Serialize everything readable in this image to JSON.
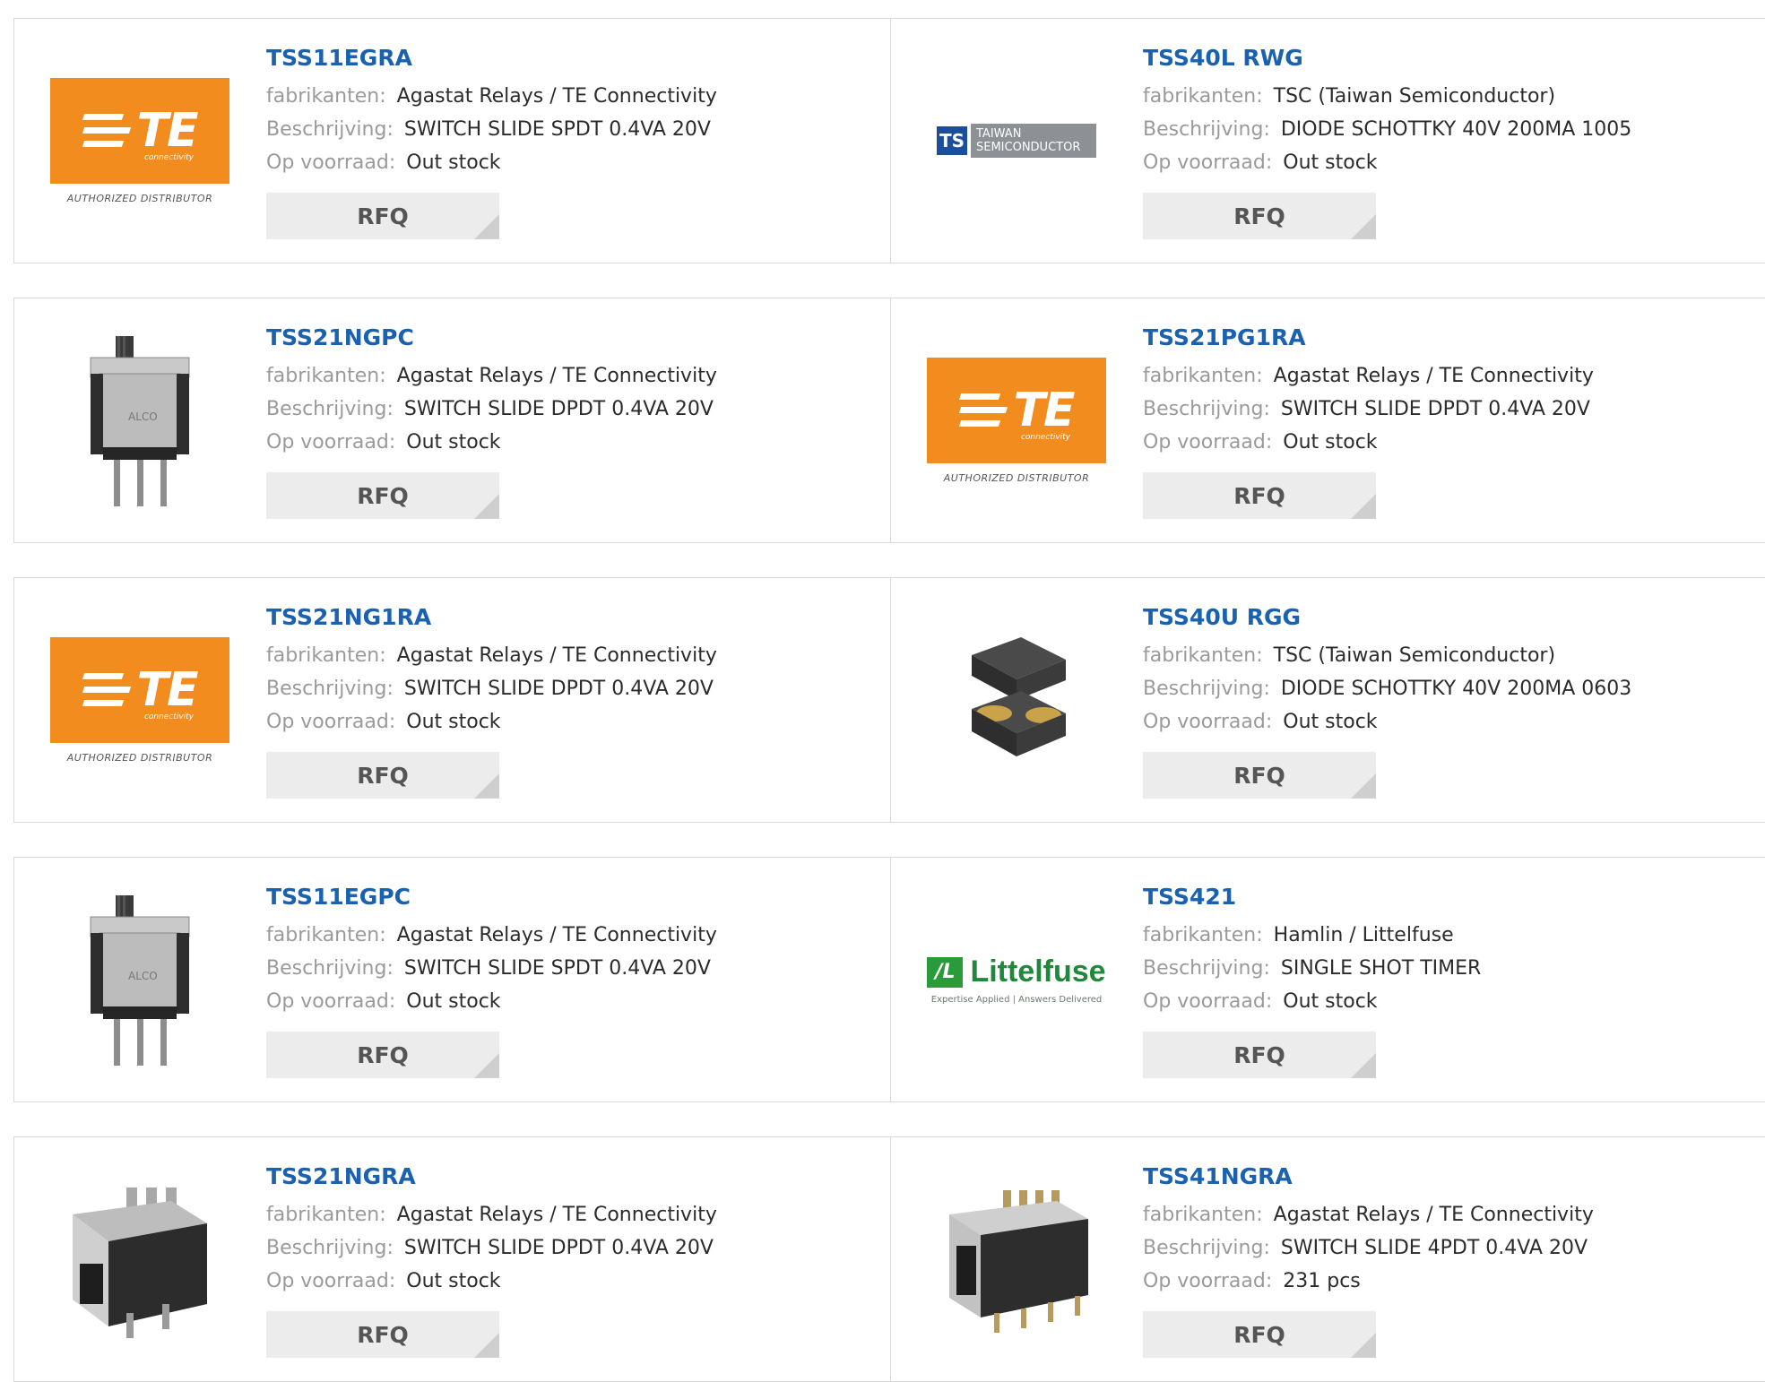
{
  "labels": {
    "manufacturer": "fabrikanten:",
    "description": "Beschrijving:",
    "stock": "Op voorraad:",
    "rfq": "RFQ"
  },
  "logos": {
    "te": {
      "brand": "TE",
      "sub": "connectivity",
      "authorized": "AUTHORIZED DISTRIBUTOR",
      "color": "#f28c1e"
    },
    "tsc": {
      "mark": "TS",
      "line1": "TAIWAN",
      "line2": "SEMICONDUCTOR"
    },
    "littelfuse": {
      "name": "Littelfuse",
      "tagline": "Expertise Applied | Answers Delivered"
    }
  },
  "colors": {
    "title": "#1a62b0",
    "label": "#9a9a9a",
    "value": "#2b2b2b",
    "rfq_bg": "#ececec"
  },
  "products": [
    {
      "part": "TSS11EGRA",
      "manufacturer": "Agastat Relays / TE Connectivity",
      "description": "SWITCH SLIDE SPDT 0.4VA 20V",
      "stock": "Out stock",
      "image": "te-logo"
    },
    {
      "part": "TSS40L RWG",
      "manufacturer": "TSC (Taiwan Semiconductor)",
      "description": "DIODE SCHOTTKY 40V 200MA 1005",
      "stock": "Out stock",
      "image": "taiwan-semiconductor-logo"
    },
    {
      "part": "TSS21NGPC",
      "manufacturer": "Agastat Relays / TE Connectivity",
      "description": "SWITCH SLIDE DPDT 0.4VA 20V",
      "stock": "Out stock",
      "image": "slide-switch-photo"
    },
    {
      "part": "TSS21PG1RA",
      "manufacturer": "Agastat Relays / TE Connectivity",
      "description": "SWITCH SLIDE DPDT 0.4VA 20V",
      "stock": "Out stock",
      "image": "te-logo"
    },
    {
      "part": "TSS21NG1RA",
      "manufacturer": "Agastat Relays / TE Connectivity",
      "description": "SWITCH SLIDE DPDT 0.4VA 20V",
      "stock": "Out stock",
      "image": "te-logo"
    },
    {
      "part": "TSS40U RGG",
      "manufacturer": "TSC (Taiwan Semiconductor)",
      "description": "DIODE SCHOTTKY 40V 200MA 0603",
      "stock": "Out stock",
      "image": "diode-chip-photo"
    },
    {
      "part": "TSS11EGPC",
      "manufacturer": "Agastat Relays / TE Connectivity",
      "description": "SWITCH SLIDE SPDT 0.4VA 20V",
      "stock": "Out stock",
      "image": "slide-switch-photo"
    },
    {
      "part": "TSS421",
      "manufacturer": "Hamlin / Littelfuse",
      "description": "SINGLE SHOT TIMER",
      "stock": "Out stock",
      "image": "littelfuse-logo"
    },
    {
      "part": "TSS21NGRA",
      "manufacturer": "Agastat Relays / TE Connectivity",
      "description": "SWITCH SLIDE DPDT 0.4VA 20V",
      "stock": "Out stock",
      "image": "right-angle-switch-photo"
    },
    {
      "part": "TSS41NGRA",
      "manufacturer": "Agastat Relays / TE Connectivity",
      "description": "SWITCH SLIDE 4PDT 0.4VA 20V",
      "stock": "231 pcs",
      "image": "4pdt-switch-photo"
    }
  ]
}
